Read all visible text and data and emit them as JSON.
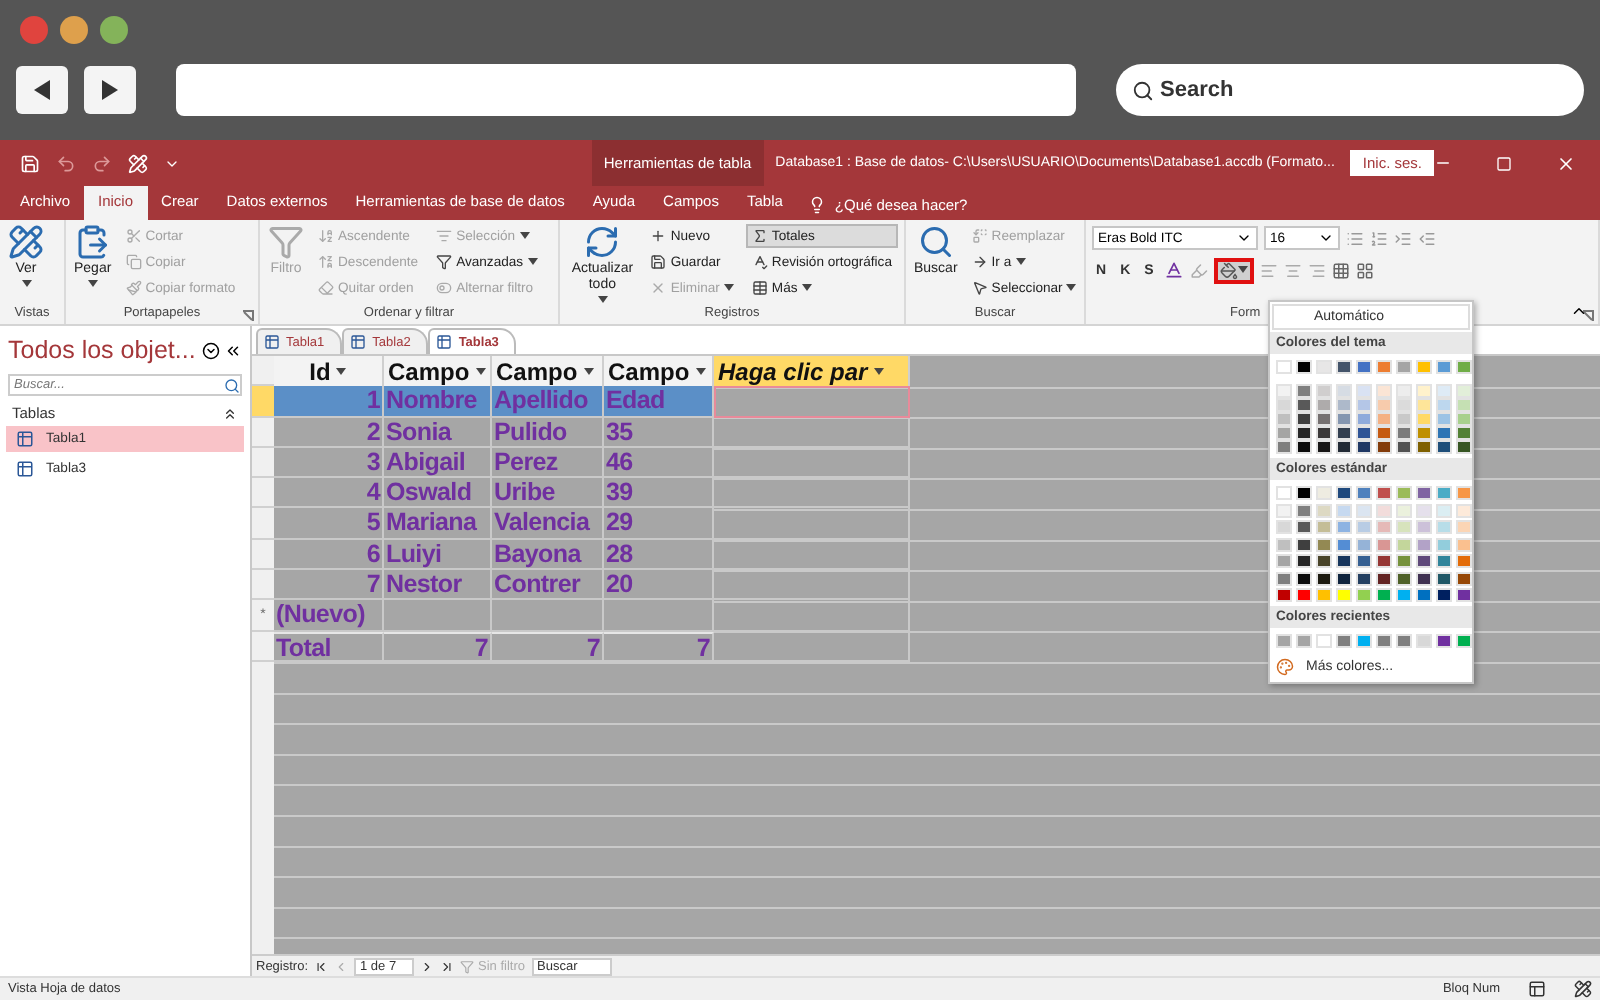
{
  "browser": {
    "search_placeholder": "Search"
  },
  "titlebar": {
    "context_group": "Herramientas de tabla",
    "title": "Database1 : Base de datos- C:\\Users\\USUARIO\\Documents\\Database1.accdb (Formato...",
    "sign_in": "Inic. ses."
  },
  "ribbon_tabs": [
    {
      "label": "Archivo",
      "selected": false
    },
    {
      "label": "Inicio",
      "selected": true
    },
    {
      "label": "Crear",
      "selected": false
    },
    {
      "label": "Datos externos",
      "selected": false
    },
    {
      "label": "Herramientas de base de datos",
      "selected": false
    },
    {
      "label": "Ayuda",
      "selected": false
    },
    {
      "label": "Campos",
      "selected": false
    },
    {
      "label": "Tabla",
      "selected": false
    }
  ],
  "tell_me": "¿Qué desea hacer?",
  "groups": [
    {
      "kind": "commands",
      "label": "Vistas",
      "launcher": false,
      "large": [
        {
          "label": "Ver",
          "caret": true,
          "disabled": false
        }
      ]
    },
    {
      "kind": "commands",
      "label": "Portapapeles",
      "launcher": true,
      "large": [
        {
          "label": "Pegar",
          "caret": true,
          "disabled": false
        }
      ],
      "columns": [
        [
          {
            "label": "Cortar",
            "disabled": true,
            "caret": false,
            "pressed": false
          },
          {
            "label": "Copiar",
            "disabled": true,
            "caret": false,
            "pressed": false
          },
          {
            "label": "Copiar formato",
            "disabled": true,
            "caret": false,
            "pressed": false
          }
        ]
      ]
    },
    {
      "kind": "commands",
      "label": "Ordenar y filtrar",
      "launcher": false,
      "large": [
        {
          "label": "Filtro",
          "caret": false,
          "disabled": true
        }
      ],
      "columns": [
        [
          {
            "label": "Ascendente",
            "disabled": true,
            "caret": false,
            "pressed": false
          },
          {
            "label": "Descendente",
            "disabled": true,
            "caret": false,
            "pressed": false
          },
          {
            "label": "Quitar orden",
            "disabled": true,
            "caret": false,
            "pressed": false
          }
        ],
        [
          {
            "label": "Selección",
            "disabled": true,
            "caret": true,
            "pressed": false
          },
          {
            "label": "Avanzadas",
            "disabled": false,
            "caret": true,
            "pressed": false
          },
          {
            "label": "Alternar filtro",
            "disabled": true,
            "caret": false,
            "pressed": false
          }
        ]
      ]
    },
    {
      "kind": "commands",
      "label": "Registros",
      "launcher": false,
      "large": [
        {
          "label": "Actualizar todo",
          "caret": true,
          "disabled": false
        }
      ],
      "columns": [
        [
          {
            "label": "Nuevo",
            "disabled": false,
            "caret": false,
            "pressed": false
          },
          {
            "label": "Guardar",
            "disabled": false,
            "caret": false,
            "pressed": false
          },
          {
            "label": "Eliminar",
            "disabled": true,
            "caret": true,
            "pressed": false
          }
        ],
        [
          {
            "label": "Totales",
            "disabled": false,
            "caret": false,
            "pressed": true
          },
          {
            "label": "Revisión ortográfica",
            "disabled": false,
            "caret": false,
            "pressed": false
          },
          {
            "label": "Más",
            "disabled": false,
            "caret": true,
            "pressed": false
          }
        ]
      ]
    },
    {
      "kind": "commands",
      "label": "Buscar",
      "launcher": false,
      "large": [
        {
          "label": "Buscar",
          "caret": false,
          "disabled": false
        }
      ],
      "columns": [
        [
          {
            "label": "Reemplazar",
            "disabled": true,
            "caret": false,
            "pressed": false
          },
          {
            "label": "Ir a",
            "disabled": false,
            "caret": true,
            "pressed": false
          },
          {
            "label": "Seleccionar",
            "disabled": false,
            "caret": true,
            "pressed": false
          }
        ]
      ]
    },
    {
      "kind": "font",
      "label": "Form",
      "launcher": true,
      "font": "Eras Bold ITC",
      "size": "16",
      "styles": [
        "N",
        "K",
        "S"
      ],
      "fill_highlighted": true
    }
  ],
  "nav_pane": {
    "title": "Todos los objet...",
    "search_placeholder": "Buscar...",
    "section": "Tablas",
    "items": [
      {
        "label": "Tabla1",
        "selected": true
      },
      {
        "label": "Tabla3",
        "selected": false
      }
    ]
  },
  "doc_tabs": [
    {
      "label": "Tabla1",
      "selected": false
    },
    {
      "label": "Tabla2",
      "selected": false
    },
    {
      "label": "Tabla3",
      "selected": true
    }
  ],
  "datasheet": {
    "columns": [
      {
        "label": "Id",
        "kind": "field"
      },
      {
        "label": "Campo",
        "kind": "field"
      },
      {
        "label": "Campo",
        "kind": "field"
      },
      {
        "label": "Campo",
        "kind": "field"
      },
      {
        "label": "Haga clic par",
        "kind": "add"
      }
    ],
    "rows": [
      {
        "kind": "record",
        "selected": true,
        "cells": [
          "1",
          "Nombre",
          "Apellido",
          "Edad"
        ]
      },
      {
        "kind": "record",
        "selected": false,
        "cells": [
          "2",
          "Sonia",
          "Pulido",
          "35"
        ]
      },
      {
        "kind": "record",
        "selected": false,
        "cells": [
          "3",
          "Abigail",
          "Perez",
          "46"
        ]
      },
      {
        "kind": "record",
        "selected": false,
        "cells": [
          "4",
          "Oswald",
          "Uribe",
          "39"
        ]
      },
      {
        "kind": "record",
        "selected": false,
        "cells": [
          "5",
          "Mariana",
          "Valencia",
          "29"
        ]
      },
      {
        "kind": "record",
        "selected": false,
        "cells": [
          "6",
          "Luiyi",
          "Bayona",
          "28"
        ]
      },
      {
        "kind": "record",
        "selected": false,
        "cells": [
          "7",
          "Nestor",
          "Contrer",
          "20"
        ]
      },
      {
        "kind": "new",
        "selected": false,
        "selector": "*",
        "cells": [
          "(Nuevo)",
          "",
          "",
          ""
        ]
      },
      {
        "kind": "total",
        "selected": false,
        "cells": [
          "Total",
          "7",
          "7",
          "7"
        ]
      }
    ]
  },
  "record_nav": {
    "label": "Registro:",
    "position": "1 de 7",
    "filter": "Sin filtro",
    "search_placeholder": "Buscar"
  },
  "status_bar": {
    "left": "Vista Hoja de datos",
    "right": "Bloq Num"
  },
  "palette": {
    "automatic": "Automático",
    "theme_title": "Colores del tema",
    "theme_colors": [
      {
        "color": "#ffffff"
      },
      {
        "color": "#000000"
      },
      {
        "color": "#e7e6e6"
      },
      {
        "color": "#44546a"
      },
      {
        "color": "#4472c4"
      },
      {
        "color": "#ed7d31"
      },
      {
        "color": "#a5a5a5"
      },
      {
        "color": "#ffc000"
      },
      {
        "color": "#5b9bd5"
      },
      {
        "color": "#70ad47"
      },
      {
        "color": "#f2f2f2"
      },
      {
        "color": "#7f7f7f"
      },
      {
        "color": "#d0cece"
      },
      {
        "color": "#d6dce4"
      },
      {
        "color": "#d9e2f3"
      },
      {
        "color": "#fbe5d5"
      },
      {
        "color": "#ededed"
      },
      {
        "color": "#fff2cc"
      },
      {
        "color": "#deebf6"
      },
      {
        "color": "#e2efd9"
      },
      {
        "color": "#d8d8d8"
      },
      {
        "color": "#595959"
      },
      {
        "color": "#aeabab"
      },
      {
        "color": "#adb9ca"
      },
      {
        "color": "#b4c6e7"
      },
      {
        "color": "#f7cbac"
      },
      {
        "color": "#dbdbdb"
      },
      {
        "color": "#fee599"
      },
      {
        "color": "#bdd7ee"
      },
      {
        "color": "#c5e0b3"
      },
      {
        "color": "#bfbfbf"
      },
      {
        "color": "#3f3f3f"
      },
      {
        "color": "#757070"
      },
      {
        "color": "#8496b0"
      },
      {
        "color": "#8eaadb"
      },
      {
        "color": "#f4b183"
      },
      {
        "color": "#c9c9c9"
      },
      {
        "color": "#ffd965"
      },
      {
        "color": "#9cc3e5"
      },
      {
        "color": "#a8d08d"
      },
      {
        "color": "#a5a5a4"
      },
      {
        "color": "#262626"
      },
      {
        "color": "#3a3838"
      },
      {
        "color": "#323f4f"
      },
      {
        "color": "#2f5496"
      },
      {
        "color": "#c55a11"
      },
      {
        "color": "#7b7b7b"
      },
      {
        "color": "#bf9000"
      },
      {
        "color": "#2e75b5"
      },
      {
        "color": "#538135"
      },
      {
        "color": "#7f7f7e"
      },
      {
        "color": "#0c0c0c"
      },
      {
        "color": "#171616"
      },
      {
        "color": "#222a35"
      },
      {
        "color": "#1f3864"
      },
      {
        "color": "#833c0b"
      },
      {
        "color": "#525252"
      },
      {
        "color": "#7f6000"
      },
      {
        "color": "#1e4e79"
      },
      {
        "color": "#375623"
      }
    ],
    "standard_title": "Colores estándar",
    "standard_colors": [
      {
        "color": "#ffffff"
      },
      {
        "color": "#000000"
      },
      {
        "color": "#eeece1"
      },
      {
        "color": "#1f497d"
      },
      {
        "color": "#4f81bd"
      },
      {
        "color": "#c0504d"
      },
      {
        "color": "#9bbb59"
      },
      {
        "color": "#8064a2"
      },
      {
        "color": "#4bacc6"
      },
      {
        "color": "#f79646"
      },
      {
        "color": "#f2f2f2"
      },
      {
        "color": "#7f7f7f"
      },
      {
        "color": "#ddd9c3"
      },
      {
        "color": "#c6d9f0"
      },
      {
        "color": "#dbe5f1"
      },
      {
        "color": "#f2dcdb"
      },
      {
        "color": "#ebf1dd"
      },
      {
        "color": "#e5e0ec"
      },
      {
        "color": "#dbeef3"
      },
      {
        "color": "#fdeada"
      },
      {
        "color": "#d8d8d8"
      },
      {
        "color": "#595959"
      },
      {
        "color": "#c4bd97"
      },
      {
        "color": "#8db3e2"
      },
      {
        "color": "#b8cce4"
      },
      {
        "color": "#e5b9b7"
      },
      {
        "color": "#d7e3bc"
      },
      {
        "color": "#ccc1d9"
      },
      {
        "color": "#b7dde8"
      },
      {
        "color": "#fbd5b5"
      },
      {
        "color": "#bfbfbf"
      },
      {
        "color": "#3f3f3f"
      },
      {
        "color": "#938953"
      },
      {
        "color": "#548dd4"
      },
      {
        "color": "#95b3d7"
      },
      {
        "color": "#d99694"
      },
      {
        "color": "#c3d69b"
      },
      {
        "color": "#b2a2c7"
      },
      {
        "color": "#92cddc"
      },
      {
        "color": "#fac08f"
      },
      {
        "color": "#a5a5a5"
      },
      {
        "color": "#262626"
      },
      {
        "color": "#494429"
      },
      {
        "color": "#17365d"
      },
      {
        "color": "#366092"
      },
      {
        "color": "#953734"
      },
      {
        "color": "#76923c"
      },
      {
        "color": "#5f497a"
      },
      {
        "color": "#31859b"
      },
      {
        "color": "#e36c09"
      },
      {
        "color": "#7f7f7f"
      },
      {
        "color": "#0c0c0c"
      },
      {
        "color": "#1d1b10"
      },
      {
        "color": "#0f243e"
      },
      {
        "color": "#244061"
      },
      {
        "color": "#632423"
      },
      {
        "color": "#4f6128"
      },
      {
        "color": "#3f3151"
      },
      {
        "color": "#205867"
      },
      {
        "color": "#974806"
      },
      {
        "color": "#c00000"
      },
      {
        "color": "#ff0000"
      },
      {
        "color": "#ffc000"
      },
      {
        "color": "#ffff00"
      },
      {
        "color": "#92d050"
      },
      {
        "color": "#00b050"
      },
      {
        "color": "#00b0f0"
      },
      {
        "color": "#0070c0"
      },
      {
        "color": "#002060"
      },
      {
        "color": "#7030a0"
      }
    ],
    "recent_title": "Colores recientes",
    "recent_colors": [
      {
        "color": "#a5a5a5"
      },
      {
        "color": "#a5a5a5"
      },
      {
        "color": "#ffffff"
      },
      {
        "color": "#7f7f7f"
      },
      {
        "color": "#00b0f0"
      },
      {
        "color": "#7f7f7f"
      },
      {
        "color": "#7f7f7f"
      },
      {
        "color": "#d8d8d8"
      },
      {
        "color": "#7030a0"
      },
      {
        "color": "#00b050"
      }
    ],
    "more": "Más colores..."
  }
}
